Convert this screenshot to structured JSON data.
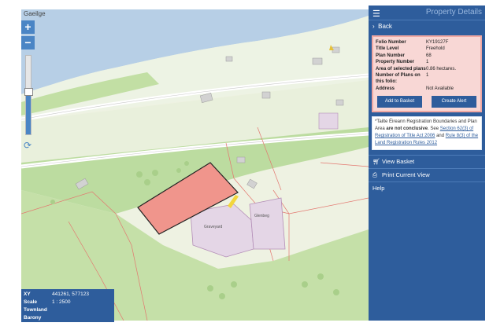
{
  "map": {
    "language_toggle": "Gaeilge",
    "zoom_in": "+",
    "zoom_out": "−",
    "zoom_level_fraction": 0.55,
    "refresh_icon": "refresh-icon",
    "labels": {
      "graveyard": "Graveyard",
      "glebe": "Glenbeg"
    },
    "colors": {
      "water": "#b7cfe6",
      "land": "#eef2e2",
      "forest": "#c2dfa4",
      "parcel": "#f0958c",
      "road": "#ffffff"
    }
  },
  "info": {
    "rows": [
      {
        "key": "XY",
        "value": "441261, 577123"
      },
      {
        "key": "Scale",
        "value": "1 : 2500"
      },
      {
        "key": "Townland",
        "value": ""
      },
      {
        "key": "Barony",
        "value": ""
      }
    ]
  },
  "panel": {
    "title": "Property Details",
    "back": "Back",
    "details": [
      {
        "key": "Folio Number",
        "value": "KY19127F"
      },
      {
        "key": "Title Level",
        "value": "Freehold"
      },
      {
        "key": "Plan Number",
        "value": "68"
      },
      {
        "key": "Property Number",
        "value": "1"
      },
      {
        "key": "Area of selected plans",
        "value": "0.86 hectares."
      },
      {
        "key": "Number of Plans on this folio:",
        "value": "1"
      },
      {
        "key": "Address",
        "value": "Not Available"
      }
    ],
    "add_to_basket": "Add to Basket",
    "create_alert": "Create Alert",
    "note": {
      "prefix": "*Tailte Éireann Registration Boundaries and Plan Area",
      "bold": "are not conclusive",
      "see": ". See",
      "link1": "Section 62(3) of Registration of Title Act 2006",
      "and": "and",
      "link2": "Rule 8(3) of the Land Registration Rules 2012"
    },
    "menu": {
      "view_basket": "View Basket",
      "print_view": "Print Current View",
      "help": "Help"
    }
  }
}
